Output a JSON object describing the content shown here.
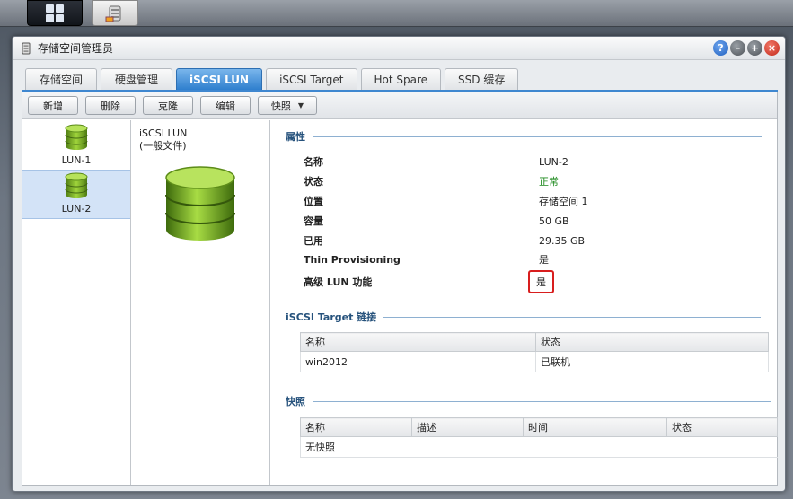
{
  "window": {
    "title": "存储空间管理员",
    "controls": [
      "?",
      "–",
      "+",
      "×"
    ]
  },
  "tabs": [
    {
      "label": "存储空间",
      "active": false
    },
    {
      "label": "硬盘管理",
      "active": false
    },
    {
      "label": "iSCSI LUN",
      "active": true
    },
    {
      "label": "iSCSI Target",
      "active": false
    },
    {
      "label": "Hot Spare",
      "active": false
    },
    {
      "label": "SSD 缓存",
      "active": false
    }
  ],
  "toolbar": {
    "new_label": "新增",
    "delete_label": "删除",
    "clone_label": "克隆",
    "edit_label": "编辑",
    "snapshot_label": "快照"
  },
  "lun_list": [
    {
      "label": "LUN-1",
      "selected": false
    },
    {
      "label": "LUN-2",
      "selected": true
    }
  ],
  "middle": {
    "type_line1": "iSCSI LUN",
    "type_line2": "(一般文件)"
  },
  "properties": {
    "heading": "属性",
    "rows": [
      {
        "key": "名称",
        "value": "LUN-2"
      },
      {
        "key": "状态",
        "value": "正常"
      },
      {
        "key": "位置",
        "value": "存储空间 1"
      },
      {
        "key": "容量",
        "value": "50 GB"
      },
      {
        "key": "已用",
        "value": "29.35 GB"
      },
      {
        "key": "Thin Provisioning",
        "value": "是"
      },
      {
        "key": "高级 LUN 功能",
        "value": "是"
      }
    ]
  },
  "target_links": {
    "heading": "iSCSI Target 链接",
    "columns": [
      "名称",
      "状态"
    ],
    "rows": [
      {
        "name": "win2012",
        "status": "已联机"
      }
    ]
  },
  "snapshots": {
    "heading": "快照",
    "columns": [
      "名称",
      "描述",
      "时间",
      "状态"
    ],
    "empty_text": "无快照"
  },
  "colors": {
    "accent": "#3f87d0",
    "status_ok": "#1e8a1e",
    "link": "#1a3fa8",
    "highlight": "#d81e1e"
  }
}
